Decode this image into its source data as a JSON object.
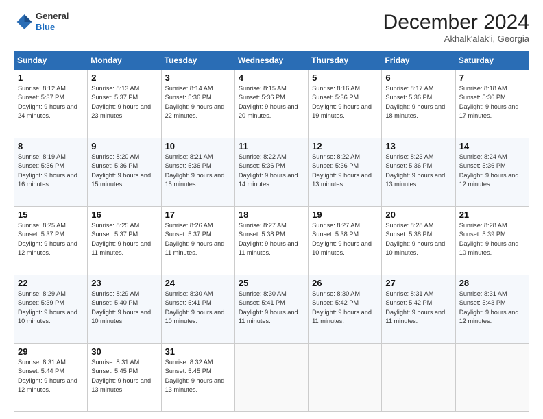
{
  "header": {
    "logo": {
      "general": "General",
      "blue": "Blue"
    },
    "title": "December 2024",
    "subtitle": "Akhalk'alak'i, Georgia"
  },
  "days_of_week": [
    "Sunday",
    "Monday",
    "Tuesday",
    "Wednesday",
    "Thursday",
    "Friday",
    "Saturday"
  ],
  "weeks": [
    [
      {
        "day": "1",
        "sunrise": "8:12 AM",
        "sunset": "5:37 PM",
        "daylight": "9 hours and 24 minutes."
      },
      {
        "day": "2",
        "sunrise": "8:13 AM",
        "sunset": "5:37 PM",
        "daylight": "9 hours and 23 minutes."
      },
      {
        "day": "3",
        "sunrise": "8:14 AM",
        "sunset": "5:36 PM",
        "daylight": "9 hours and 22 minutes."
      },
      {
        "day": "4",
        "sunrise": "8:15 AM",
        "sunset": "5:36 PM",
        "daylight": "9 hours and 20 minutes."
      },
      {
        "day": "5",
        "sunrise": "8:16 AM",
        "sunset": "5:36 PM",
        "daylight": "9 hours and 19 minutes."
      },
      {
        "day": "6",
        "sunrise": "8:17 AM",
        "sunset": "5:36 PM",
        "daylight": "9 hours and 18 minutes."
      },
      {
        "day": "7",
        "sunrise": "8:18 AM",
        "sunset": "5:36 PM",
        "daylight": "9 hours and 17 minutes."
      }
    ],
    [
      {
        "day": "8",
        "sunrise": "8:19 AM",
        "sunset": "5:36 PM",
        "daylight": "9 hours and 16 minutes."
      },
      {
        "day": "9",
        "sunrise": "8:20 AM",
        "sunset": "5:36 PM",
        "daylight": "9 hours and 15 minutes."
      },
      {
        "day": "10",
        "sunrise": "8:21 AM",
        "sunset": "5:36 PM",
        "daylight": "9 hours and 15 minutes."
      },
      {
        "day": "11",
        "sunrise": "8:22 AM",
        "sunset": "5:36 PM",
        "daylight": "9 hours and 14 minutes."
      },
      {
        "day": "12",
        "sunrise": "8:22 AM",
        "sunset": "5:36 PM",
        "daylight": "9 hours and 13 minutes."
      },
      {
        "day": "13",
        "sunrise": "8:23 AM",
        "sunset": "5:36 PM",
        "daylight": "9 hours and 13 minutes."
      },
      {
        "day": "14",
        "sunrise": "8:24 AM",
        "sunset": "5:36 PM",
        "daylight": "9 hours and 12 minutes."
      }
    ],
    [
      {
        "day": "15",
        "sunrise": "8:25 AM",
        "sunset": "5:37 PM",
        "daylight": "9 hours and 12 minutes."
      },
      {
        "day": "16",
        "sunrise": "8:25 AM",
        "sunset": "5:37 PM",
        "daylight": "9 hours and 11 minutes."
      },
      {
        "day": "17",
        "sunrise": "8:26 AM",
        "sunset": "5:37 PM",
        "daylight": "9 hours and 11 minutes."
      },
      {
        "day": "18",
        "sunrise": "8:27 AM",
        "sunset": "5:38 PM",
        "daylight": "9 hours and 11 minutes."
      },
      {
        "day": "19",
        "sunrise": "8:27 AM",
        "sunset": "5:38 PM",
        "daylight": "9 hours and 10 minutes."
      },
      {
        "day": "20",
        "sunrise": "8:28 AM",
        "sunset": "5:38 PM",
        "daylight": "9 hours and 10 minutes."
      },
      {
        "day": "21",
        "sunrise": "8:28 AM",
        "sunset": "5:39 PM",
        "daylight": "9 hours and 10 minutes."
      }
    ],
    [
      {
        "day": "22",
        "sunrise": "8:29 AM",
        "sunset": "5:39 PM",
        "daylight": "9 hours and 10 minutes."
      },
      {
        "day": "23",
        "sunrise": "8:29 AM",
        "sunset": "5:40 PM",
        "daylight": "9 hours and 10 minutes."
      },
      {
        "day": "24",
        "sunrise": "8:30 AM",
        "sunset": "5:41 PM",
        "daylight": "9 hours and 10 minutes."
      },
      {
        "day": "25",
        "sunrise": "8:30 AM",
        "sunset": "5:41 PM",
        "daylight": "9 hours and 11 minutes."
      },
      {
        "day": "26",
        "sunrise": "8:30 AM",
        "sunset": "5:42 PM",
        "daylight": "9 hours and 11 minutes."
      },
      {
        "day": "27",
        "sunrise": "8:31 AM",
        "sunset": "5:42 PM",
        "daylight": "9 hours and 11 minutes."
      },
      {
        "day": "28",
        "sunrise": "8:31 AM",
        "sunset": "5:43 PM",
        "daylight": "9 hours and 12 minutes."
      }
    ],
    [
      {
        "day": "29",
        "sunrise": "8:31 AM",
        "sunset": "5:44 PM",
        "daylight": "9 hours and 12 minutes."
      },
      {
        "day": "30",
        "sunrise": "8:31 AM",
        "sunset": "5:45 PM",
        "daylight": "9 hours and 13 minutes."
      },
      {
        "day": "31",
        "sunrise": "8:32 AM",
        "sunset": "5:45 PM",
        "daylight": "9 hours and 13 minutes."
      },
      null,
      null,
      null,
      null
    ]
  ]
}
